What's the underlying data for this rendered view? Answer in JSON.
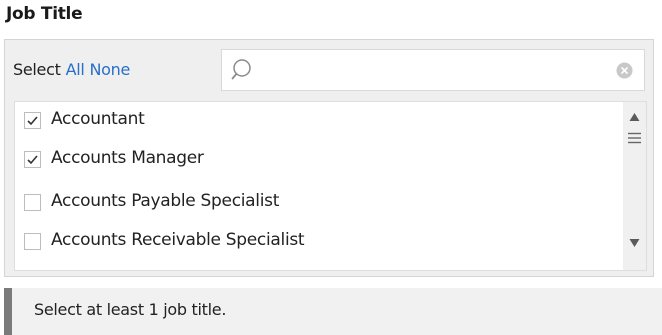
{
  "filter": {
    "title": "Job Title",
    "select_label": "Select",
    "all_label": "All",
    "none_label": "None",
    "search": {
      "value": "",
      "placeholder": ""
    },
    "items": [
      {
        "label": "Accountant",
        "checked": true
      },
      {
        "label": "Accounts Manager",
        "checked": true
      },
      {
        "label": "Accounts Payable Specialist",
        "checked": false
      },
      {
        "label": "Accounts Receivable Specialist",
        "checked": false
      }
    ]
  },
  "validation": {
    "message": "Select at least 1 job title."
  },
  "colors": {
    "link": "#2670c8",
    "panel_bg": "#efefef",
    "message_bar": "#7b7b7b"
  }
}
